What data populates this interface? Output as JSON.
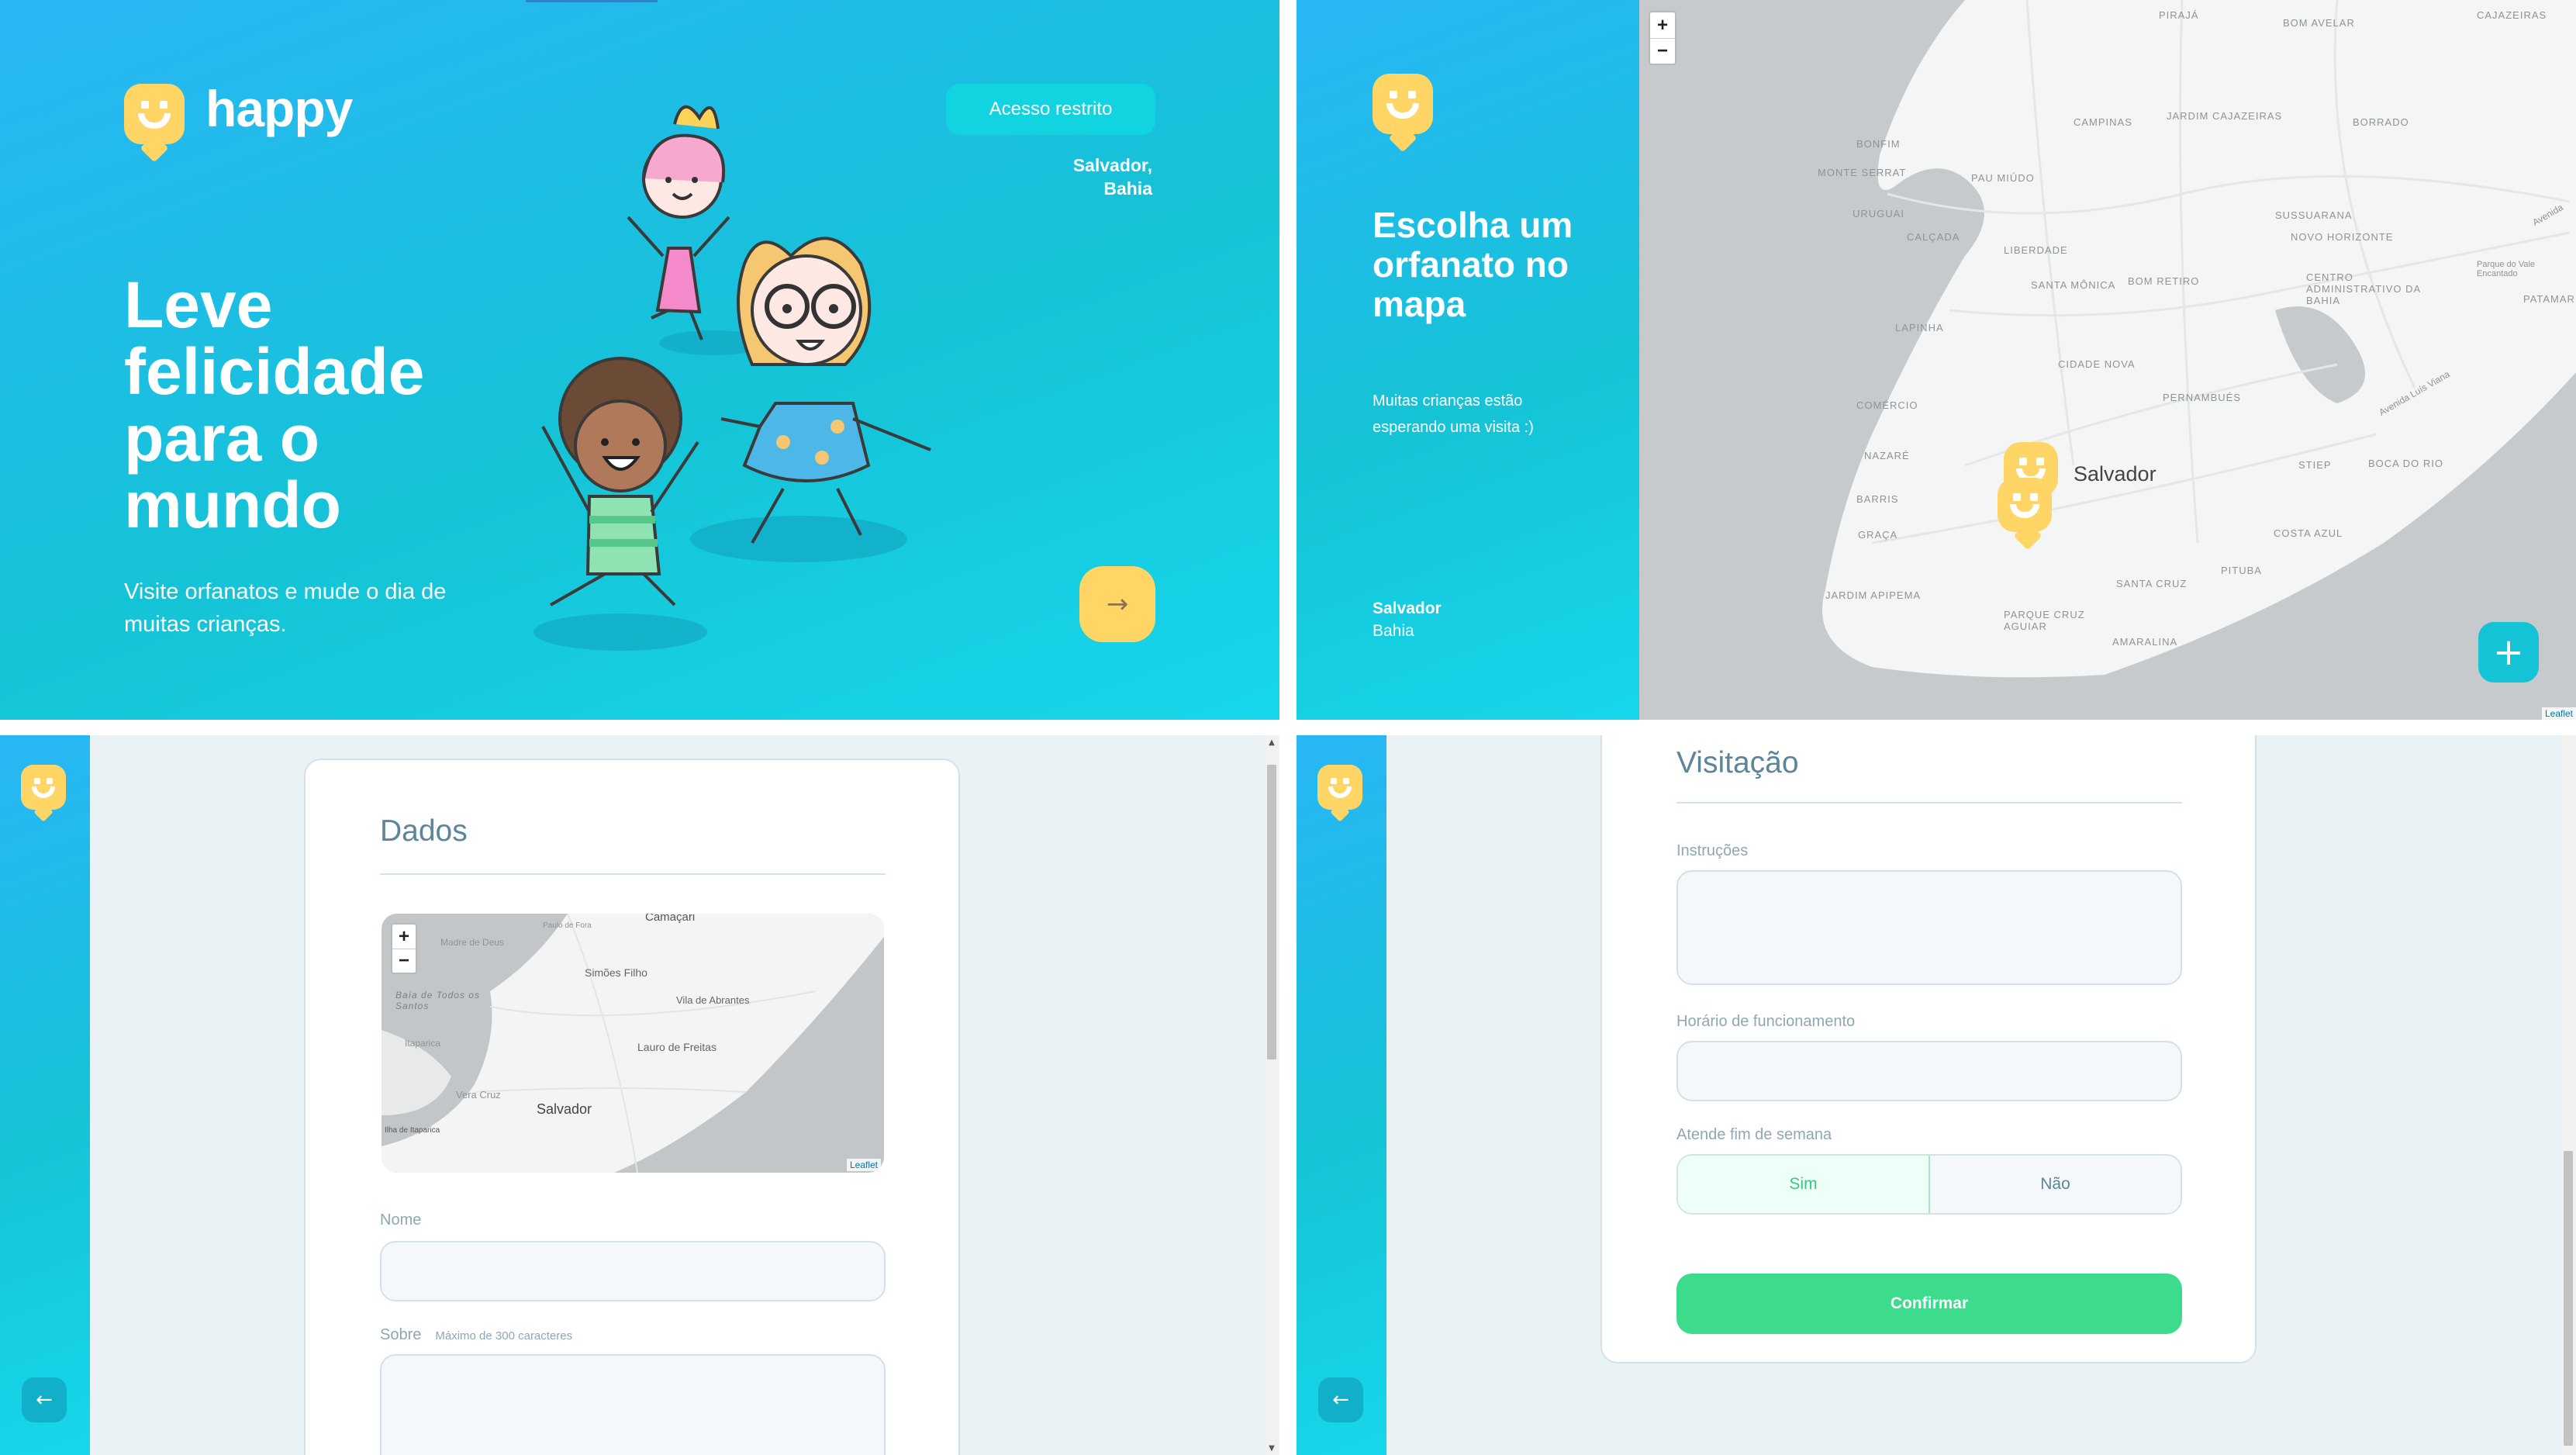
{
  "landing": {
    "brand": "happy",
    "restricted_button": "Acesso restrito",
    "location_city": "Salvador,",
    "location_state": "Bahia",
    "headline": "Leve felicidade para o mundo",
    "subline": "Visite orfanatos e mude o dia de muitas crianças.",
    "enter_icon": "→"
  },
  "map_page": {
    "title": "Escolha um orfanato no mapa",
    "subtitle": "Muitas crianças estão esperando uma visita :)",
    "city": "Salvador",
    "state": "Bahia",
    "zoom_in": "+",
    "zoom_out": "−",
    "add_icon": "+",
    "attribution": "Leaflet",
    "map_city_label": "Salvador",
    "neighborhoods": [
      "Pirajá",
      "Bom Avelar",
      "Cajazeiras",
      "Campinas",
      "Jardim Cajazeiras",
      "Borrado",
      "Bonfim",
      "Monte Serrat",
      "Uruguai",
      "Pau Miúdo",
      "Calçada",
      "Sussuarana",
      "Novo Horizonte",
      "Centro Administrativo da Bahia",
      "Liberdade",
      "Santa Mônica",
      "Lapinha",
      "Bom Retiro",
      "Cidade Nova",
      "Comércio",
      "Pernambués",
      "Nazaré",
      "Stiep",
      "Boca do Rio",
      "Barris",
      "Graça",
      "Costa Azul",
      "Jardim Apipema",
      "Pituba",
      "Santa Cruz",
      "Parque Cruz Aguiar",
      "Amaralina",
      "Patamares",
      "Parque do Vale Encantado"
    ],
    "road_labels": [
      "Avenida Luís Viana",
      "Avenida"
    ]
  },
  "form_dados": {
    "section_title": "Dados",
    "map_zoom_in": "+",
    "map_zoom_out": "−",
    "map_attribution": "Leaflet",
    "map_labels": [
      "Camaçari",
      "Madre de Deus",
      "Paulo de Fora",
      "Baía de Todos os Santos",
      "Simões Filho",
      "Vila de Abrantes",
      "Itaparica",
      "Lauro de Freitas",
      "Vera Cruz",
      "Salvador",
      "Ilha de Itaparica"
    ],
    "name_label": "Nome",
    "name_value": "",
    "about_label": "Sobre",
    "about_hint": "Máximo de 300 caracteres",
    "about_value": "",
    "back_icon": "←"
  },
  "form_visita": {
    "section_title": "Visitação",
    "instructions_label": "Instruções",
    "instructions_value": "",
    "hours_label": "Horário de funcionamento",
    "hours_value": "",
    "weekend_label": "Atende fim de semana",
    "weekend_yes": "Sim",
    "weekend_no": "Não",
    "weekend_selected": "Sim",
    "confirm_label": "Confirmar",
    "back_icon": "←"
  },
  "colors": {
    "gradient_start": "#29b6f6",
    "gradient_end": "#15c3d6",
    "logo_yellow": "#ffd666",
    "confirm_green": "#3cdc8c",
    "text_blue_gray": "#5c8599"
  },
  "icons": {
    "logo": "smiley-pin-icon",
    "enter": "arrow-right-icon",
    "add": "plus-icon",
    "back": "arrow-left-icon",
    "map_marker": "smiley-pin-icon"
  }
}
